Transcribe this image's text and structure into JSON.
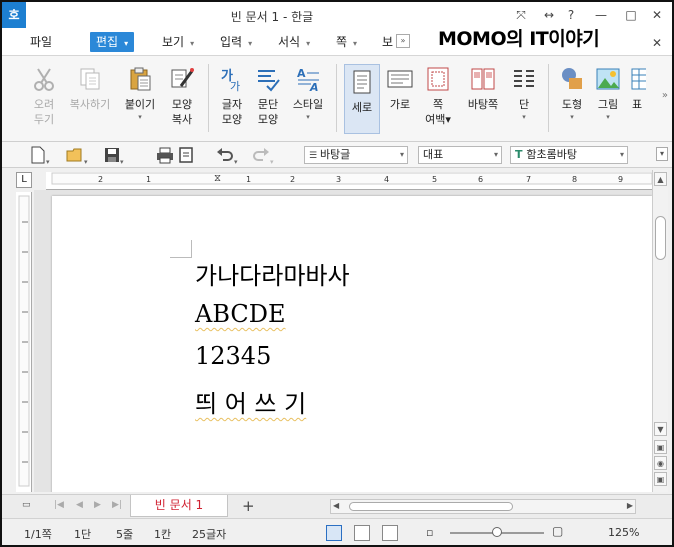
{
  "titlebar": {
    "app_logo": "호",
    "title": "빈 문서 1 - 한글",
    "buttons": [
      "⤧",
      "↔",
      "?",
      "—",
      "□",
      "✕"
    ]
  },
  "menu": {
    "items": [
      {
        "label": "파일"
      },
      {
        "label": "편집",
        "active": true
      },
      {
        "label": "보기"
      },
      {
        "label": "입력"
      },
      {
        "label": "서식"
      },
      {
        "label": "쪽"
      },
      {
        "label": "보안"
      }
    ],
    "more": "»",
    "close": "✕"
  },
  "watermark": "MOMO의 IT이야기",
  "ribbon": {
    "buttons": [
      {
        "line1": "오려",
        "line2": "두기",
        "disabled": true,
        "icon": "scissors-icon"
      },
      {
        "line1": "복사하기",
        "line2": "",
        "disabled": true,
        "icon": "copy-icon"
      },
      {
        "line1": "붙이기",
        "line2": "▾",
        "icon": "paste-icon"
      },
      {
        "line1": "모양",
        "line2": "복사",
        "icon": "format-painter-icon"
      },
      {
        "line1": "글자",
        "line2": "모양",
        "icon": "char-shape-icon"
      },
      {
        "line1": "문단",
        "line2": "모양",
        "icon": "paragraph-shape-icon"
      },
      {
        "line1": "스타일",
        "line2": "▾",
        "icon": "style-icon"
      },
      {
        "line1": "세로",
        "line2": "",
        "selected": true,
        "icon": "portrait-icon"
      },
      {
        "line1": "가로",
        "line2": "",
        "icon": "landscape-icon"
      },
      {
        "line1": "쪽",
        "line2": "여백▾",
        "icon": "margin-icon"
      },
      {
        "line1": "바탕쪽",
        "line2": "",
        "icon": "master-page-icon"
      },
      {
        "line1": "단",
        "line2": "▾",
        "icon": "columns-icon"
      },
      {
        "line1": "도형",
        "line2": "▾",
        "icon": "shape-icon"
      },
      {
        "line1": "그림",
        "line2": "▾",
        "icon": "picture-icon"
      },
      {
        "line1": "표",
        "line2": "",
        "icon": "table-icon"
      }
    ]
  },
  "toolbar": {
    "style_combo": "바탕글",
    "lang_combo": "대표",
    "font_combo": "함초롬바탕"
  },
  "ruler": {
    "h_ticks": [
      "2",
      "1",
      "1",
      "2",
      "3",
      "4",
      "5",
      "6",
      "7",
      "8",
      "9"
    ]
  },
  "document": {
    "lines": [
      "가나다라마바사",
      "ABCDE",
      "12345",
      "띄 어 쓰 기"
    ]
  },
  "tabs": {
    "doc_tab": "빈 문서 1",
    "add": "+"
  },
  "status": {
    "page": "1/1쪽",
    "column": "1단",
    "line": "5줄",
    "col": "1칸",
    "chars": "25글자",
    "zoom": "125%",
    "zoom_level": 0.5
  }
}
